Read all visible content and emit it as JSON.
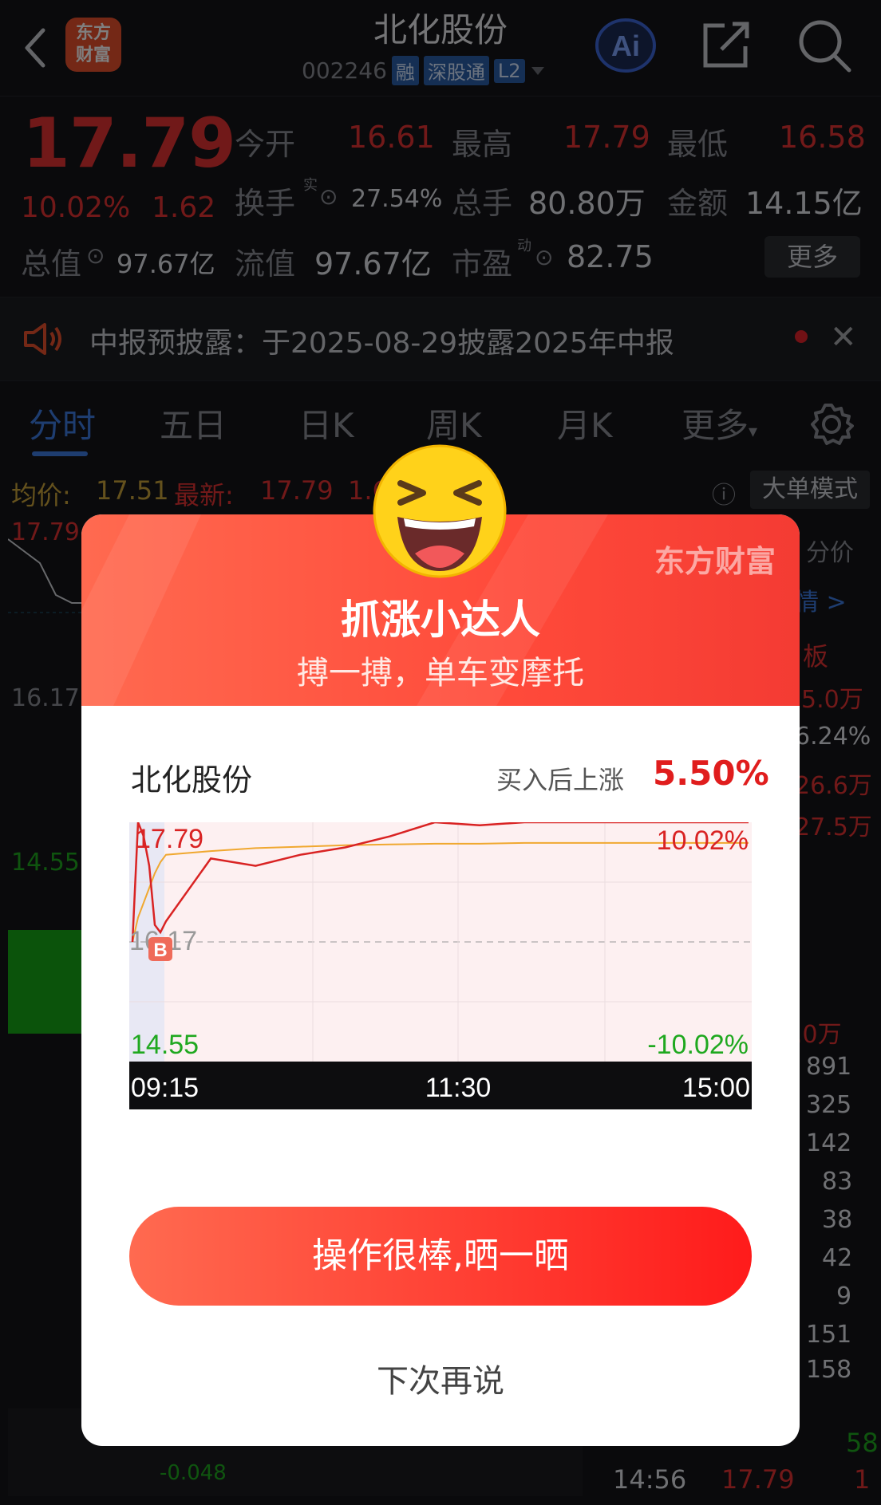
{
  "header": {
    "logo_text_line1": "东方",
    "logo_text_line2": "财富",
    "stock_name": "北化股份",
    "stock_code": "002246",
    "tags": [
      "融",
      "深股通",
      "L2"
    ]
  },
  "quote": {
    "price": "17.79",
    "pct": "10.02%",
    "change": "1.62",
    "open_label": "今开",
    "open_value": "16.61",
    "high_label": "最高",
    "high_value": "17.79",
    "low_label": "最低",
    "low_value": "16.58",
    "turnover_label": "换手",
    "turnover_sup": "实",
    "turnover_value": "27.54%",
    "volume_label": "总手",
    "volume_value": "80.80万",
    "amount_label": "金额",
    "amount_value": "14.15亿",
    "mcap_label": "总值",
    "mcap_value": "97.67亿",
    "float_label": "流值",
    "float_value": "97.67亿",
    "pe_label": "市盈",
    "pe_sup": "动",
    "pe_value": "82.75",
    "more_label": "更多"
  },
  "notice": {
    "text": "中报预披露：于2025-08-29披露2025年中报"
  },
  "tabs": [
    "分时",
    "五日",
    "日K",
    "周K",
    "月K",
    "更多"
  ],
  "avg_row": {
    "avg_label": "均价:",
    "avg_value": "17.51",
    "latest_label": "最新:",
    "latest_value": "17.79",
    "latest_more": "1.6",
    "bigorder_label": "大单模式"
  },
  "background": {
    "chart_labels": [
      "17.79",
      "16.17",
      "14.55"
    ],
    "right_labels": [
      "分价",
      "情 >",
      "板",
      "5.0万",
      "6.24%",
      "26.6万",
      "27.5万",
      ".0万",
      "891",
      "325",
      "142",
      "83",
      "38",
      "42",
      "9",
      "151",
      "158"
    ],
    "bottom_value": "-0.048",
    "ticks": [
      {
        "time": "14:56",
        "price": "17.79",
        "vol": "1"
      },
      {
        "time": "14:56",
        "price": "17.79",
        "vol": "58"
      }
    ]
  },
  "modal": {
    "brand": "东方财富",
    "title": "抓涨小达人",
    "subtitle": "搏一搏，单车变摩托",
    "stock": "北化股份",
    "rise_label": "买入后上涨",
    "rise_value": "5.50%",
    "primary_button": "操作很棒,晒一晒",
    "later_link": "下次再说",
    "buy_marker": "B"
  },
  "chart_data": {
    "type": "line",
    "title": "",
    "xlabel": "",
    "ylabel": "",
    "x_ticks": [
      "09:15",
      "11:30",
      "15:00"
    ],
    "ylim": [
      14.55,
      17.79
    ],
    "y_labels_left": [
      "17.79",
      "16.17",
      "14.55"
    ],
    "y_labels_right": [
      "10.02%",
      "-10.02%"
    ],
    "prev_close": 16.17,
    "series": [
      {
        "values": [
          16.17,
          17.79,
          17.6,
          17.2,
          16.4,
          16.3,
          16.45,
          17.3,
          17.2,
          17.35,
          17.45,
          17.6,
          17.79,
          17.75,
          17.79,
          17.79,
          17.79,
          17.79,
          17.79,
          17.79
        ]
      },
      {
        "values": [
          16.17,
          16.5,
          16.7,
          16.9,
          17.1,
          17.25,
          17.35,
          17.4,
          17.44,
          17.46,
          17.48,
          17.49,
          17.5,
          17.5,
          17.51,
          17.51,
          17.51,
          17.51,
          17.51,
          17.51
        ]
      }
    ],
    "buy_index": 5
  },
  "colors": {
    "up": "#e23232",
    "down": "#1fa81f",
    "accent": "#3d7ae0",
    "modal_red": "#ff4a3a"
  }
}
